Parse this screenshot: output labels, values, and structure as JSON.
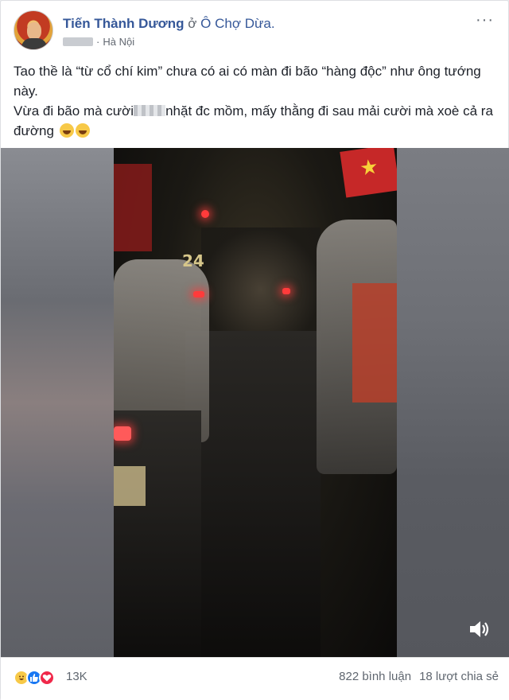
{
  "post": {
    "author": "Tiến Thành Dương",
    "at_word": "ở",
    "place": "Ô Chợ Dừa.",
    "separator": "·",
    "location": "Hà Nội",
    "menu_label": "···",
    "text_line1": "Tao thề là “từ cổ chí kim” chưa có ai có màn đi bão “hàng độc” như ông tướng này.",
    "text_line2_start": "Vừa đi bão mà cười",
    "text_line2_end": "nhặt đc mồm, mấy thằng đi sau mải cười mà xoè cả ra đường"
  },
  "video": {
    "sound_icon": "speaker-icon",
    "flag_star": "★",
    "jersey_number": "24"
  },
  "footer": {
    "reaction_count": "13K",
    "comments": "822 bình luận",
    "shares": "18 lượt chia sẻ"
  },
  "colors": {
    "link": "#365899",
    "muted": "#616770",
    "like": "#1877f2",
    "love": "#f0284a",
    "haha": "#f7c948"
  }
}
